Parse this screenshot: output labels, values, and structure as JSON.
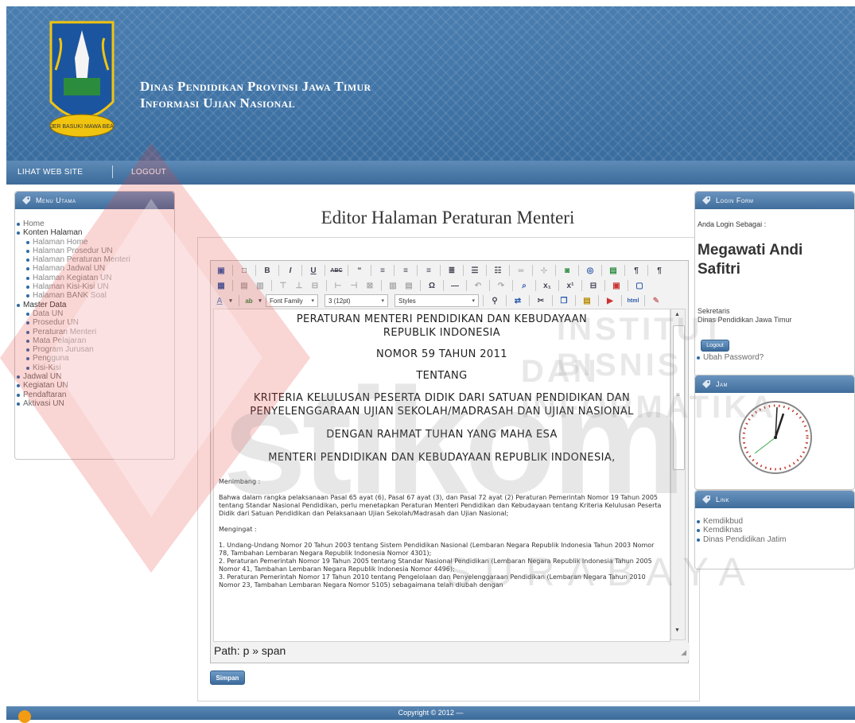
{
  "header": {
    "title_line1": "Dinas Pendidikan Provinsi Jawa Timur",
    "title_line2": "Informasi Ujian Nasional",
    "logo_motto": "JER BASUKI MAWA BEA"
  },
  "topnav": {
    "items": [
      "Lihat Web Site",
      "Logout"
    ]
  },
  "left_menu": {
    "title": "Menu Utama",
    "items": [
      {
        "label": "Home",
        "level": 0
      },
      {
        "label": "Konten Halaman",
        "level": 0
      },
      {
        "label": "Halaman Home",
        "level": 1
      },
      {
        "label": "Halaman Prosedur UN",
        "level": 1
      },
      {
        "label": "Halaman Peraturan Menteri",
        "level": 1
      },
      {
        "label": "Halaman Jadwal UN",
        "level": 1
      },
      {
        "label": "Halaman Kegiatan UN",
        "level": 1
      },
      {
        "label": "Halaman Kisi-Kisi UN",
        "level": 1
      },
      {
        "label": "Halaman BANK Soal",
        "level": 1
      },
      {
        "label": "Master Data",
        "level": 0
      },
      {
        "label": "Data UN",
        "level": 1
      },
      {
        "label": "Prosedur UN",
        "level": 1
      },
      {
        "label": "Peraturan Menteri",
        "level": 1
      },
      {
        "label": "Mata Pelajaran",
        "level": 1
      },
      {
        "label": "Program Jurusan",
        "level": 1
      },
      {
        "label": "Pengguna",
        "level": 1
      },
      {
        "label": "Kisi-Kisi",
        "level": 1
      },
      {
        "label": "Jadwal UN",
        "level": 0
      },
      {
        "label": "Kegiatan UN",
        "level": 0
      },
      {
        "label": "Pendaftaran",
        "level": 0
      },
      {
        "label": "Aktivasi UN",
        "level": 0
      }
    ]
  },
  "main": {
    "page_title": "Editor Halaman Peraturan Menteri",
    "toolbar": {
      "font_family": "Font Family",
      "font_size": "3 (12pt)",
      "styles": "Styles"
    },
    "document": {
      "headings": [
        "PERATURAN MENTERI PENDIDIKAN DAN KEBUDAYAAN",
        "REPUBLIK INDONESIA",
        "NOMOR 59 TAHUN 2011",
        "TENTANG",
        "KRITERIA KELULUSAN PESERTA DIDIK DARI SATUAN PENDIDIKAN DAN PENYELENGGARAAN UJIAN SEKOLAH/MADRASAH DAN UJIAN NASIONAL",
        "DENGAN RAHMAT TUHAN YANG MAHA ESA",
        "MENTERI PENDIDIKAN DAN KEBUDAYAAN REPUBLIK INDONESIA,"
      ],
      "menimbang_label": "Menimbang   :",
      "menimbang_text": "Bahwa dalam rangka pelaksanaan Pasal 65 ayat (6), Pasal 67 ayat (3), dan Pasal 72 ayat (2) Peraturan Pemerintah Nomor 19 Tahun 2005 tentang Standar Nasional Pendidikan, perlu menetapkan Peraturan Menteri Pendidikan dan Kebudayaan tentang Kriteria Kelulusan Peserta Didik dari Satuan Pendidikan dan Pelaksanaan Ujian Sekolah/Madrasah dan Ujian Nasional;",
      "mengingat_label": "Mengingat   :",
      "mengingat_items": [
        "1. Undang-Undang Nomor 20 Tahun 2003 tentang Sistem Pendidikan Nasional (Lembaran Negara Republik Indonesia Tahun 2003 Nomor 78, Tambahan Lembaran Negara Republik Indonesia Nomor 4301);",
        "2. Peraturan Pemerintah Nomor 19 Tahun 2005 tentang Standar Nasional Pendidikan (Lembaran Negara Republik Indonesia Tahun 2005  Nomor 41, Tambahan Lembaran Negara Republik Indonesia Nomor 4496);",
        "3. Peraturan Pemerintah Nomor 17 Tahun 2010 tentang Pengelolaan dan Penyelenggaraan Pendidikan (Lembaran Negara Tahun 2010 Nomor 23, Tambahan Lembaran Negara Nomor 5105) sebagaimana telah diubah dengan"
      ]
    },
    "path": "Path: p » span",
    "save_label": "Simpan"
  },
  "login": {
    "title": "Login Form",
    "prompt": "Anda Login Sebagai :",
    "user_name": "Megawati Andi Safitri",
    "role": "Sekretaris",
    "org": "Dinas Pendidikan Jawa Timur",
    "logout_label": "Logout",
    "change_password": "Ubah Password?"
  },
  "clock": {
    "title": "Jam"
  },
  "links": {
    "title": "Link",
    "items": [
      "Kemdikbud",
      "Kemdiknas",
      "Dinas Pendidikan Jatim"
    ]
  },
  "footer": {
    "copyright": "Copyright © 2012 —"
  },
  "watermark": {
    "line1": "INSTITUT BISNIS",
    "line2": "DAN INFORMATIKA",
    "brand": "stikom",
    "city": "SURABAYA"
  },
  "colors": {
    "header_blue": "#3a6d9f",
    "accent": "#2f6aa6",
    "watermark_red": "#e33e3a"
  }
}
